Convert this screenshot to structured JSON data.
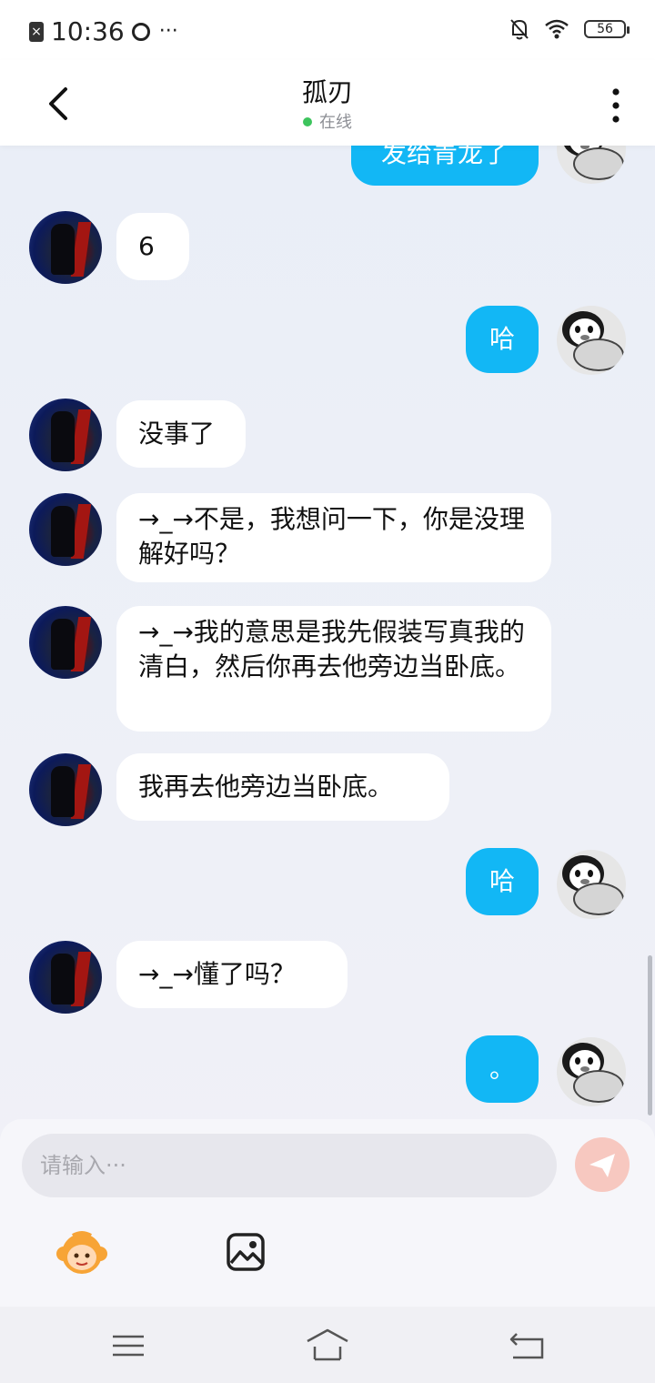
{
  "status_bar": {
    "time": "10:36",
    "battery": "56",
    "more_indicator": "···"
  },
  "header": {
    "title": "孤刃",
    "status": "在线",
    "status_color": "#3dc45d"
  },
  "messages": [
    {
      "side": "right",
      "text": "发给青龙了",
      "partial": true
    },
    {
      "side": "left",
      "text": "6"
    },
    {
      "side": "right",
      "text": "哈"
    },
    {
      "side": "left",
      "text": "没事了"
    },
    {
      "side": "left",
      "text": "→_→不是，我想问一下，你是没理解好吗？"
    },
    {
      "side": "left",
      "text": "→_→我的意思是我先假装写真我的清白，然后你再去他旁边当卧底。"
    },
    {
      "side": "left",
      "text": "我再去他旁边当卧底。"
    },
    {
      "side": "right",
      "text": "哈"
    },
    {
      "side": "left",
      "text": "→_→懂了吗？"
    },
    {
      "side": "right",
      "text": "。"
    }
  ],
  "input": {
    "placeholder": "请输入···",
    "value": ""
  },
  "icons": {
    "back": "chevron-left-icon",
    "more": "more-vertical-icon",
    "send": "send-icon",
    "emoji": "emoji-face-icon",
    "image": "image-icon",
    "nav_menu": "menu-icon",
    "nav_home": "home-icon",
    "nav_back": "back-arrow-icon"
  },
  "colors": {
    "accent_bubble": "#12b7f5",
    "send_button": "#f7c8c0"
  }
}
